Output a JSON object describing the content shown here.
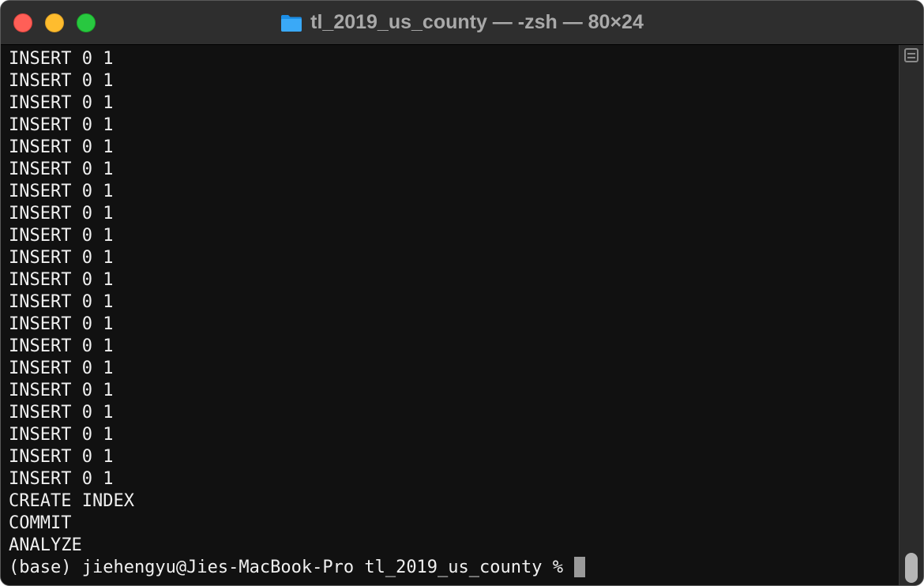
{
  "window": {
    "title": "tl_2019_us_county — -zsh — 80×24",
    "folder_icon": "folder-icon",
    "colors": {
      "close": "#ff5f57",
      "minimize": "#febc2e",
      "maximize": "#28c840",
      "background": "#111111",
      "text": "#f0f0f0"
    }
  },
  "terminal": {
    "lines": [
      "INSERT 0 1",
      "INSERT 0 1",
      "INSERT 0 1",
      "INSERT 0 1",
      "INSERT 0 1",
      "INSERT 0 1",
      "INSERT 0 1",
      "INSERT 0 1",
      "INSERT 0 1",
      "INSERT 0 1",
      "INSERT 0 1",
      "INSERT 0 1",
      "INSERT 0 1",
      "INSERT 0 1",
      "INSERT 0 1",
      "INSERT 0 1",
      "INSERT 0 1",
      "INSERT 0 1",
      "INSERT 0 1",
      "INSERT 0 1",
      "CREATE INDEX",
      "COMMIT",
      "ANALYZE"
    ],
    "prompt": "(base) jiehengyu@Jies-MacBook-Pro tl_2019_us_county %"
  }
}
